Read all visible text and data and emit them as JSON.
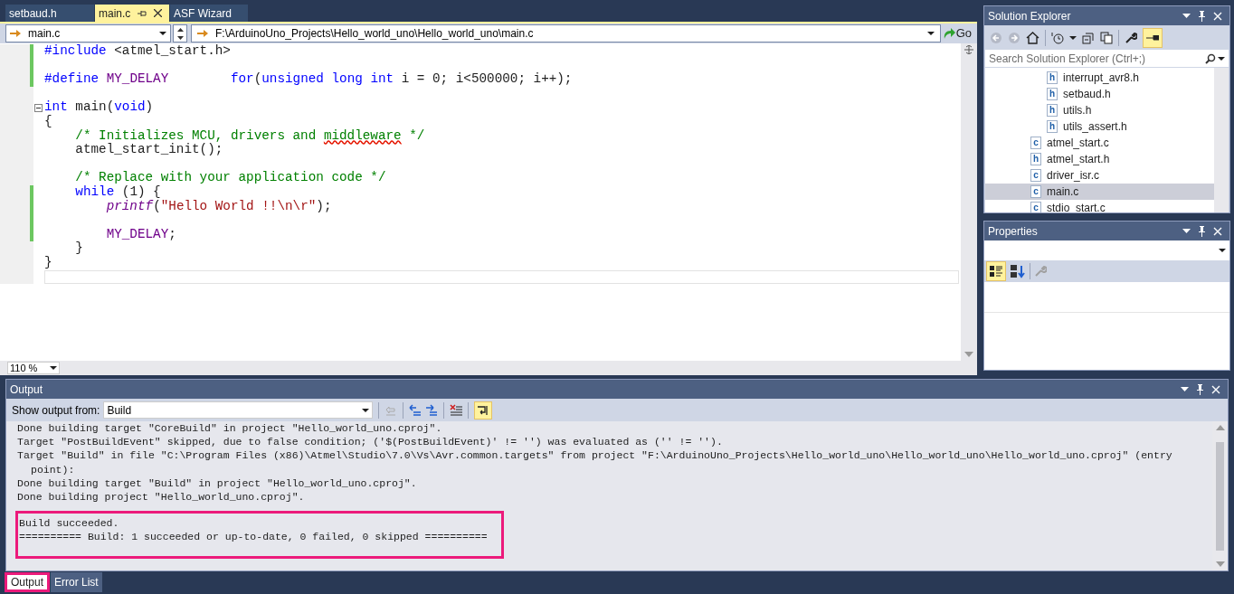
{
  "doc_tabs": [
    {
      "label": "setbaud.h",
      "selected": false
    },
    {
      "label": "main.c",
      "selected": true
    },
    {
      "label": "ASF Wizard",
      "selected": false
    }
  ],
  "nav_bar": {
    "scope": "main.c",
    "path": "F:\\ArduinoUno_Projects\\Hello_world_uno\\Hello_world_uno\\main.c",
    "go": "Go"
  },
  "code_lines": [
    {
      "changed": true,
      "fold": false,
      "tokens": [
        {
          "kind": "keyword",
          "text": "#include"
        },
        {
          "kind": "plain",
          "text": " <atmel_start.h>"
        }
      ]
    },
    {
      "changed": true,
      "fold": false
    },
    {
      "changed": true,
      "fold": false,
      "tokens": [
        {
          "kind": "keyword",
          "text": "#define "
        },
        {
          "kind": "macro",
          "text": "MY_DELAY        "
        },
        {
          "kind": "keyword",
          "text": "for"
        },
        {
          "kind": "plain",
          "text": "("
        },
        {
          "kind": "keyword",
          "text": "unsigned long int"
        },
        {
          "kind": "plain",
          "text": " i = 0; i<500000; i++);"
        }
      ]
    },
    {
      "changed": false,
      "fold": false
    },
    {
      "changed": false,
      "fold": true,
      "tokens": [
        {
          "kind": "keyword",
          "text": "int"
        },
        {
          "kind": "plain",
          "text": " main("
        },
        {
          "kind": "keyword",
          "text": "void"
        },
        {
          "kind": "plain",
          "text": ")"
        }
      ]
    },
    {
      "changed": false,
      "fold": false,
      "tokens": [
        {
          "kind": "plain",
          "text": "{"
        }
      ]
    },
    {
      "changed": false,
      "fold": false,
      "tokens": [
        {
          "kind": "comment",
          "text": "    /* Initializes MCU, drivers and "
        },
        {
          "kind": "misspelled",
          "text": "middleware"
        },
        {
          "kind": "comment",
          "text": " */"
        }
      ]
    },
    {
      "changed": false,
      "fold": false,
      "tokens": [
        {
          "kind": "plain",
          "text": "    atmel_start_init();"
        }
      ]
    },
    {
      "changed": false,
      "fold": false
    },
    {
      "changed": false,
      "fold": false,
      "tokens": [
        {
          "kind": "comment",
          "text": "    /* Replace with your application code */"
        }
      ]
    },
    {
      "changed": true,
      "fold": false,
      "tokens": [
        {
          "kind": "keyword",
          "text": "    while"
        },
        {
          "kind": "plain",
          "text": " (1) {"
        }
      ]
    },
    {
      "changed": true,
      "fold": false,
      "tokens": [
        {
          "kind": "function",
          "text": "        printf"
        },
        {
          "kind": "plain",
          "text": "("
        },
        {
          "kind": "string",
          "text": "\"Hello World !!\\n\\r\""
        },
        {
          "kind": "plain",
          "text": ");"
        }
      ]
    },
    {
      "changed": true,
      "fold": false
    },
    {
      "changed": true,
      "fold": false,
      "tokens": [
        {
          "kind": "macro",
          "text": "        MY_DELAY"
        },
        {
          "kind": "plain",
          "text": ";"
        }
      ]
    },
    {
      "changed": false,
      "fold": false,
      "tokens": [
        {
          "kind": "plain",
          "text": "    }"
        }
      ]
    },
    {
      "changed": false,
      "fold": false,
      "tokens": [
        {
          "kind": "plain",
          "text": "}"
        }
      ]
    },
    {
      "changed": false,
      "fold": false
    }
  ],
  "zoom": "110 %",
  "solution_explorer": {
    "title": "Solution Explorer",
    "search": {
      "placeholder": "Search Solution Explorer (Ctrl+;)"
    },
    "items": [
      {
        "children": [
          {
            "label": "interrupt_avr8.h",
            "badge": "h",
            "selected": false
          },
          {
            "label": "setbaud.h",
            "badge": "h",
            "selected": false
          },
          {
            "label": "utils.h",
            "badge": "h",
            "selected": false
          },
          {
            "label": "utils_assert.h",
            "badge": "h",
            "selected": false
          }
        ]
      },
      {
        "label": "atmel_start.c",
        "badge": "c",
        "selected": false
      },
      {
        "label": "atmel_start.h",
        "badge": "h",
        "selected": false
      },
      {
        "label": "driver_isr.c",
        "badge": "c",
        "selected": false
      },
      {
        "label": "main.c",
        "badge": "c",
        "selected": true
      },
      {
        "label": "stdio_start.c",
        "badge": "c",
        "selected": false
      }
    ]
  },
  "properties": {
    "title": "Properties"
  },
  "output": {
    "title": "Output",
    "source_label": "Show output from:",
    "source": "Build",
    "lines": [
      {
        "text": "Done building target \"CoreBuild\" in project \"Hello_world_uno.cproj\".",
        "indented": false
      },
      {
        "text": "Target \"PostBuildEvent\" skipped, due to false condition; ('$(PostBuildEvent)' != '') was evaluated as ('' != '').",
        "indented": false
      },
      {
        "text": "Target \"Build\" in file \"C:\\Program Files (x86)\\Atmel\\Studio\\7.0\\Vs\\Avr.common.targets\" from project \"F:\\ArduinoUno_Projects\\Hello_world_uno\\Hello_world_uno\\Hello_world_uno.cproj\" (entry",
        "indented": false
      },
      {
        "text": "point):",
        "indented": true
      },
      {
        "text": "Done building target \"Build\" in project \"Hello_world_uno.cproj\".",
        "indented": false
      },
      {
        "text": "Done building project \"Hello_world_uno.cproj\".",
        "indented": false
      }
    ],
    "boxed_lines": [
      "Build succeeded.",
      "========== Build: 1 succeeded or up-to-date, 0 failed, 0 skipped =========="
    ]
  },
  "bottom_tabs": [
    {
      "label": "Output",
      "selected": true,
      "boxed": true
    },
    {
      "label": "Error List",
      "selected": false,
      "boxed": false
    }
  ]
}
